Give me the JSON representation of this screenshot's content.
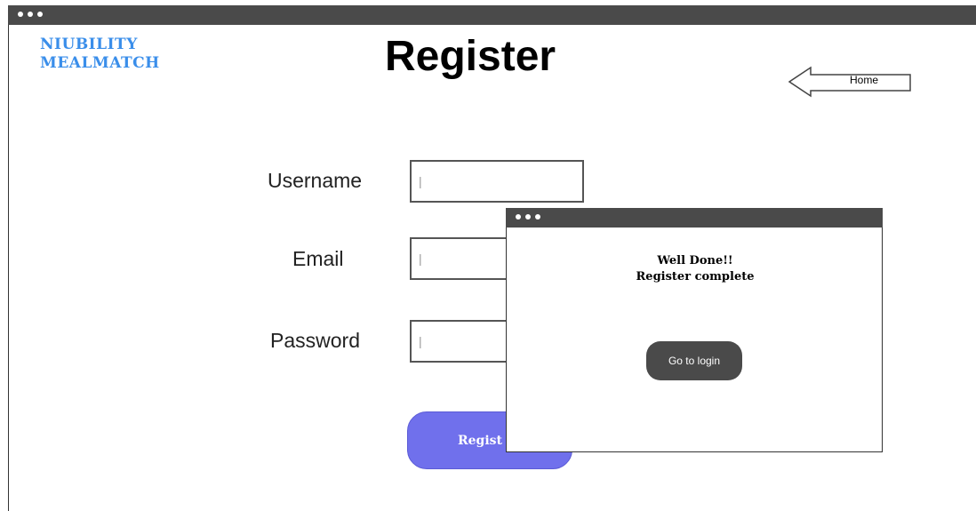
{
  "app": {
    "logo_line1": "NIUBILITY",
    "logo_line2": "MEALMATCH",
    "title": "Register"
  },
  "nav": {
    "home_label": "Home"
  },
  "form": {
    "username_label": "Username",
    "email_label": "Email",
    "password_label": "Password",
    "username_value": "|",
    "email_value": "|",
    "password_value": "|",
    "register_label": "Regist"
  },
  "modal": {
    "message_line1": "Well Done!!",
    "message_line2": "Register complete",
    "button_label": "Go to login"
  },
  "colors": {
    "accent": "#3a8eea",
    "register_button": "#7070ec",
    "titlebar": "#4a4a4a"
  }
}
